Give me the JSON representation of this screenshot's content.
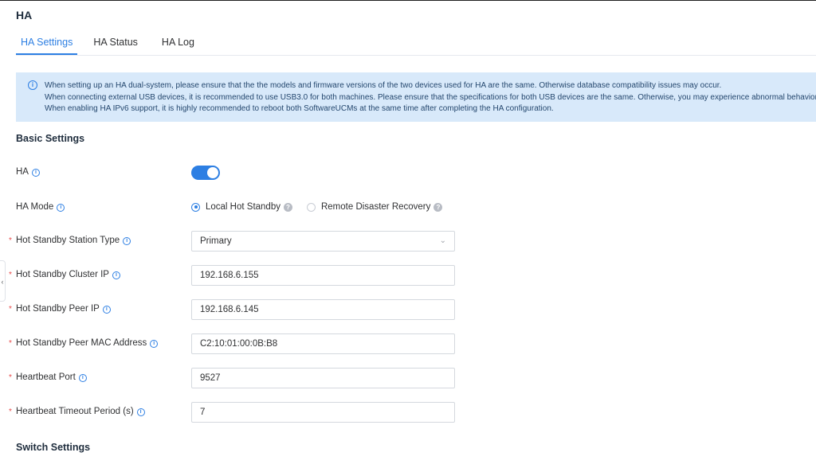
{
  "page": {
    "title": "HA"
  },
  "tabs": [
    {
      "label": "HA Settings",
      "active": true
    },
    {
      "label": "HA Status",
      "active": false
    },
    {
      "label": "HA Log",
      "active": false
    }
  ],
  "notice": {
    "lines": [
      "When setting up an HA dual-system, please ensure that the the models and firmware versions of the two devices used for HA are the same. Otherwise database compatibility issues may occur.",
      "When connecting external USB devices, it is recommended to use USB3.0 for both machines. Please ensure that the specifications for both USB devices are the same. Otherwise, you may experience abnormal behavior.",
      "When enabling HA IPv6 support, it is highly recommended to reboot both SoftwareUCMs at the same time after completing the HA configuration."
    ]
  },
  "basic_settings": {
    "title": "Basic Settings",
    "ha": {
      "label": "HA",
      "enabled": true
    },
    "ha_mode": {
      "label": "HA Mode",
      "options": [
        {
          "label": "Local Hot Standby",
          "checked": true
        },
        {
          "label": "Remote Disaster Recovery",
          "checked": false
        }
      ]
    },
    "station_type": {
      "label": "Hot Standby Station Type",
      "value": "Primary"
    },
    "cluster_ip": {
      "label": "Hot Standby Cluster IP",
      "value": "192.168.6.155"
    },
    "peer_ip": {
      "label": "Hot Standby Peer IP",
      "value": "192.168.6.145"
    },
    "peer_mac": {
      "label": "Hot Standby Peer MAC Address",
      "value": "C2:10:01:00:0B:B8"
    },
    "heartbeat_port": {
      "label": "Heartbeat Port",
      "value": "9527"
    },
    "heartbeat_timeout": {
      "label": "Heartbeat Timeout Period (s)",
      "value": "7"
    }
  },
  "switch_settings": {
    "title": "Switch Settings"
  },
  "colors": {
    "accent": "#2d7fe3",
    "notice_bg": "#d8e9fa",
    "required": "#e84a4a"
  }
}
